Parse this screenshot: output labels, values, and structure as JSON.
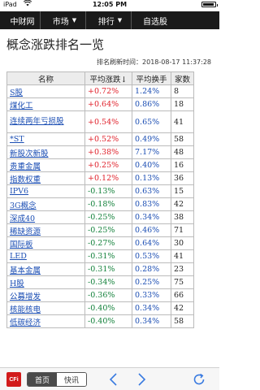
{
  "status": {
    "carrier": "iPad",
    "time": "12:05 PM",
    "battery_level": 0.95
  },
  "nav": {
    "items": [
      "中财网",
      "市场",
      "排行",
      "自选股"
    ]
  },
  "page_title": "概念涨跌排名一览",
  "refresh_label": "排名刷新时间：",
  "refresh_time": "2018-08-17 11:37:28",
  "table": {
    "headers": [
      "名称",
      "平均涨跌↓",
      "平均换手",
      "家数"
    ],
    "rows": [
      {
        "name": "S股",
        "change": "+0.72%",
        "turnover": "1.24%",
        "count": "8",
        "dir": "up"
      },
      {
        "name": "煤化工",
        "change": "+0.64%",
        "turnover": "0.86%",
        "count": "18",
        "dir": "up"
      },
      {
        "name": "连续两年亏损股",
        "change": "+0.54%",
        "turnover": "0.65%",
        "count": "41",
        "dir": "up",
        "tall": true
      },
      {
        "name": "*ST",
        "change": "+0.52%",
        "turnover": "0.49%",
        "count": "58",
        "dir": "up"
      },
      {
        "name": "新股次新股",
        "change": "+0.38%",
        "turnover": "7.17%",
        "count": "48",
        "dir": "up"
      },
      {
        "name": "贵重金属",
        "change": "+0.25%",
        "turnover": "0.40%",
        "count": "16",
        "dir": "up"
      },
      {
        "name": "指数权重",
        "change": "+0.12%",
        "turnover": "0.13%",
        "count": "36",
        "dir": "up"
      },
      {
        "name": "IPV6",
        "change": "-0.13%",
        "turnover": "0.63%",
        "count": "15",
        "dir": "down"
      },
      {
        "name": "3G概念",
        "change": "-0.18%",
        "turnover": "0.83%",
        "count": "42",
        "dir": "down"
      },
      {
        "name": "深成40",
        "change": "-0.25%",
        "turnover": "0.34%",
        "count": "38",
        "dir": "down"
      },
      {
        "name": "稀缺资源",
        "change": "-0.25%",
        "turnover": "0.46%",
        "count": "71",
        "dir": "down"
      },
      {
        "name": "国际板",
        "change": "-0.27%",
        "turnover": "0.64%",
        "count": "30",
        "dir": "down"
      },
      {
        "name": "LED",
        "change": "-0.31%",
        "turnover": "0.53%",
        "count": "41",
        "dir": "down"
      },
      {
        "name": "基本金属",
        "change": "-0.31%",
        "turnover": "0.28%",
        "count": "23",
        "dir": "down"
      },
      {
        "name": "H股",
        "change": "-0.34%",
        "turnover": "0.25%",
        "count": "75",
        "dir": "down"
      },
      {
        "name": "公募增发",
        "change": "-0.36%",
        "turnover": "0.33%",
        "count": "66",
        "dir": "down"
      },
      {
        "name": "核能核电",
        "change": "-0.40%",
        "turnover": "0.34%",
        "count": "42",
        "dir": "down"
      },
      {
        "name": "低碳经济",
        "change": "-0.40%",
        "turnover": "0.34%",
        "count": "58",
        "dir": "down"
      }
    ]
  },
  "bottom": {
    "logo_text": "CFi",
    "logo_sub": "CN",
    "tabs": [
      "首页",
      "快讯"
    ],
    "active_tab": 0
  },
  "colors": {
    "up": "#e0202a",
    "down": "#12803a",
    "link": "#1a4db3",
    "nav_bg": "#1a1a1a"
  },
  "icons": {
    "back": "back-arrow-icon",
    "forward": "forward-arrow-icon",
    "refresh": "refresh-icon"
  }
}
